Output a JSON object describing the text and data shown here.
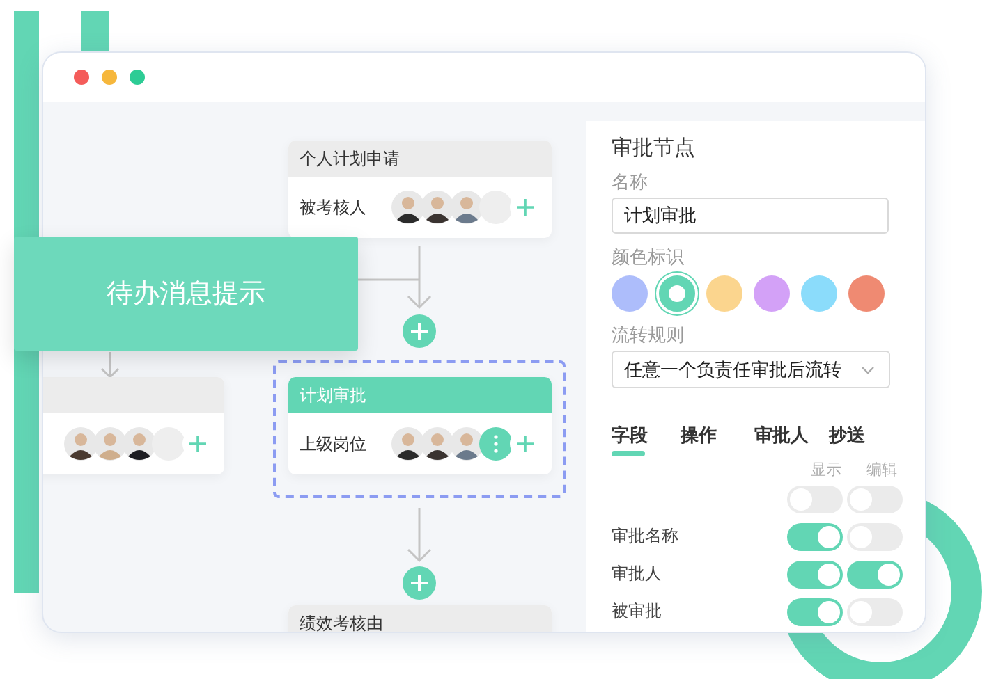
{
  "window": {
    "controls": [
      {
        "color": "#f45c5a"
      },
      {
        "color": "#f6b73c"
      },
      {
        "color": "#2dcc95"
      }
    ]
  },
  "flow": {
    "nodes": [
      {
        "title": "个人计划申请",
        "label": "被考核人",
        "selected": false,
        "avatars": [
          {
            "kind": "person"
          },
          {
            "kind": "person"
          },
          {
            "kind": "person"
          },
          {
            "kind": "blank"
          }
        ]
      },
      {
        "selected": false,
        "avatars": [
          {
            "kind": "person"
          },
          {
            "kind": "person"
          },
          {
            "kind": "person"
          },
          {
            "kind": "blank"
          }
        ]
      },
      {
        "title": "计划审批",
        "label": "上级岗位",
        "selected": true,
        "avatars": [
          {
            "kind": "person"
          },
          {
            "kind": "person"
          },
          {
            "kind": "person"
          },
          {
            "kind": "more"
          }
        ]
      },
      {
        "title": "绩效考核由",
        "selected": false
      }
    ]
  },
  "callout": {
    "text": "待办消息提示"
  },
  "panel": {
    "title": "审批节点",
    "name_label": "名称",
    "name_value": "计划审批",
    "color_label": "颜色标识",
    "colors": [
      {
        "color": "#adbdfb",
        "selected": false
      },
      {
        "color": "#62d6b4",
        "selected": true
      },
      {
        "color": "#fbd58e",
        "selected": false
      },
      {
        "color": "#d3a1f7",
        "selected": false
      },
      {
        "color": "#8bdcfb",
        "selected": false
      },
      {
        "color": "#ef8a72",
        "selected": false
      }
    ],
    "rule_label": "流转规则",
    "rule_value": "任意一个负责任审批后流转",
    "tabs": [
      {
        "label": "字段",
        "selected": true
      },
      {
        "label": "操作",
        "selected": false
      },
      {
        "label": "审批人",
        "selected": false
      },
      {
        "label": "抄送",
        "selected": false
      }
    ],
    "columns": [
      "显示",
      "编辑"
    ],
    "rows": [
      {
        "show_on": false,
        "edit_on": false
      },
      {
        "label": "审批名称",
        "show_on": true,
        "edit_on": false
      },
      {
        "label": "审批人",
        "show_on": true,
        "edit_on": true
      },
      {
        "label": "被审批",
        "show_on": true,
        "edit_on": false
      }
    ]
  }
}
